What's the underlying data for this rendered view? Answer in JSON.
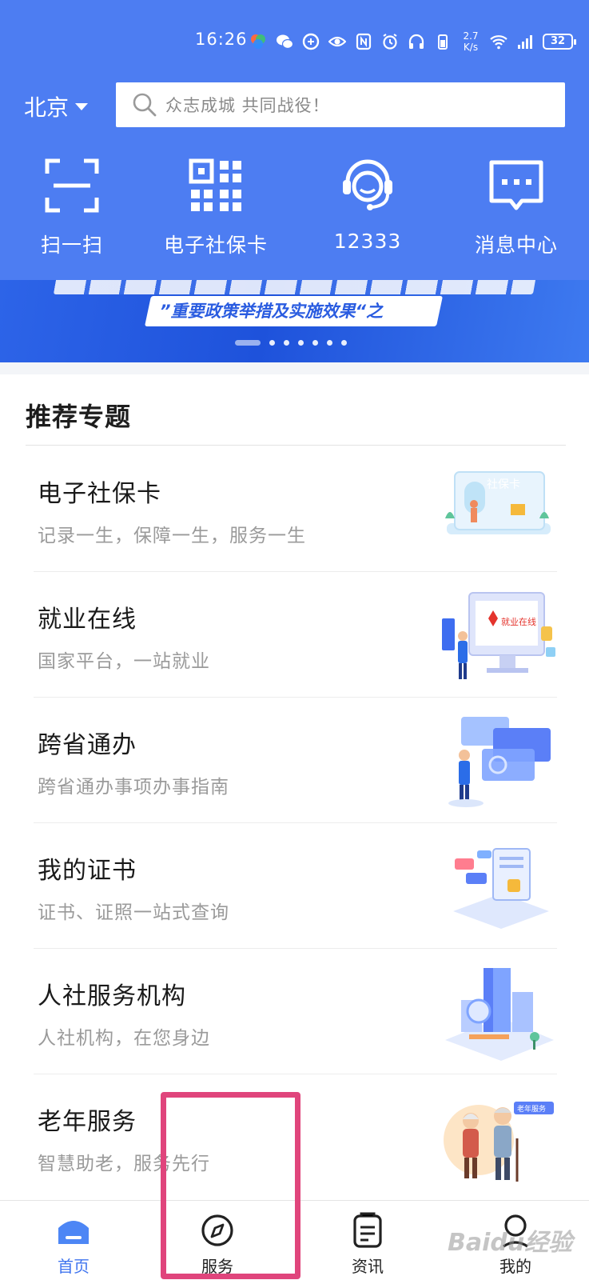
{
  "status_bar": {
    "time": "16:26",
    "net_speed": "2.7 K/s",
    "battery": "32"
  },
  "header": {
    "city": "北京",
    "search_placeholder": "众志成城 共同战役！",
    "quick_actions": [
      {
        "label": "扫一扫",
        "icon": "scan-icon"
      },
      {
        "label": "电子社保卡",
        "icon": "qr-code-icon"
      },
      {
        "label": "12333",
        "icon": "headset-icon"
      },
      {
        "label": "消息中心",
        "icon": "message-icon"
      }
    ]
  },
  "banner": {
    "ribbon_text": "”重要政策举措及实施效果“之",
    "slide_count": 7,
    "active_slide": 1
  },
  "recommend": {
    "title": "推荐专题",
    "items": [
      {
        "title": "电子社保卡",
        "subtitle": "记录一生，保障一生，服务一生",
        "art_text": "社保卡"
      },
      {
        "title": "就业在线",
        "subtitle": "国家平台，一站就业",
        "art_text": "就业在线"
      },
      {
        "title": "跨省通办",
        "subtitle": "跨省通办事项办事指南",
        "art_text": ""
      },
      {
        "title": "我的证书",
        "subtitle": "证书、证照一站式查询",
        "art_text": ""
      },
      {
        "title": "人社服务机构",
        "subtitle": "人社机构，在您身边",
        "art_text": ""
      },
      {
        "title": "老年服务",
        "subtitle": "智慧助老，服务先行",
        "art_text": "老年服务"
      }
    ]
  },
  "tabbar": {
    "tabs": [
      {
        "label": "首页",
        "icon": "home-icon",
        "active": true
      },
      {
        "label": "服务",
        "icon": "compass-icon",
        "active": false
      },
      {
        "label": "资讯",
        "icon": "news-icon",
        "active": false
      },
      {
        "label": "我的",
        "icon": "profile-icon",
        "active": false
      }
    ]
  },
  "watermark": "Baidu经验",
  "colors": {
    "header_blue": "#4d7df2",
    "active_tab": "#3f74ef",
    "highlight_box": "#e0457c"
  }
}
